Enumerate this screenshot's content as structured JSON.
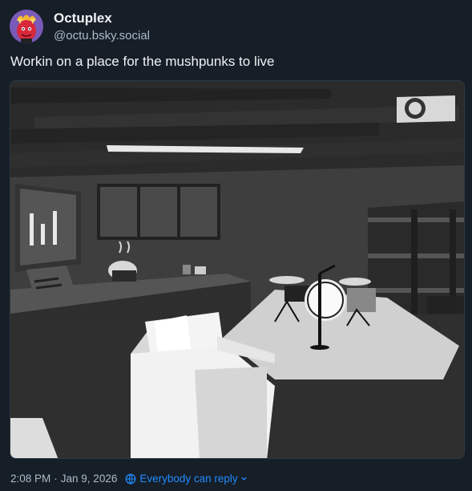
{
  "post": {
    "author": {
      "display_name": "Octuplex",
      "handle": "@octu.bsky.social",
      "avatar_icon": "devil-avatar"
    },
    "text": "Workin on a place for the mushpunks to live",
    "media": {
      "type": "image",
      "icon": "rendered-room-scene"
    },
    "timestamp": "2:08 PM",
    "date": "Jan 9, 2026",
    "separator": "·",
    "reply_setting": {
      "label": "Everybody can reply",
      "icon": "globe-icon",
      "chevron": "chevron-down-icon"
    }
  },
  "colors": {
    "background": "#161e27",
    "text_primary": "#f1f3f5",
    "text_secondary": "#aebbc9",
    "accent": "#208bfe"
  }
}
